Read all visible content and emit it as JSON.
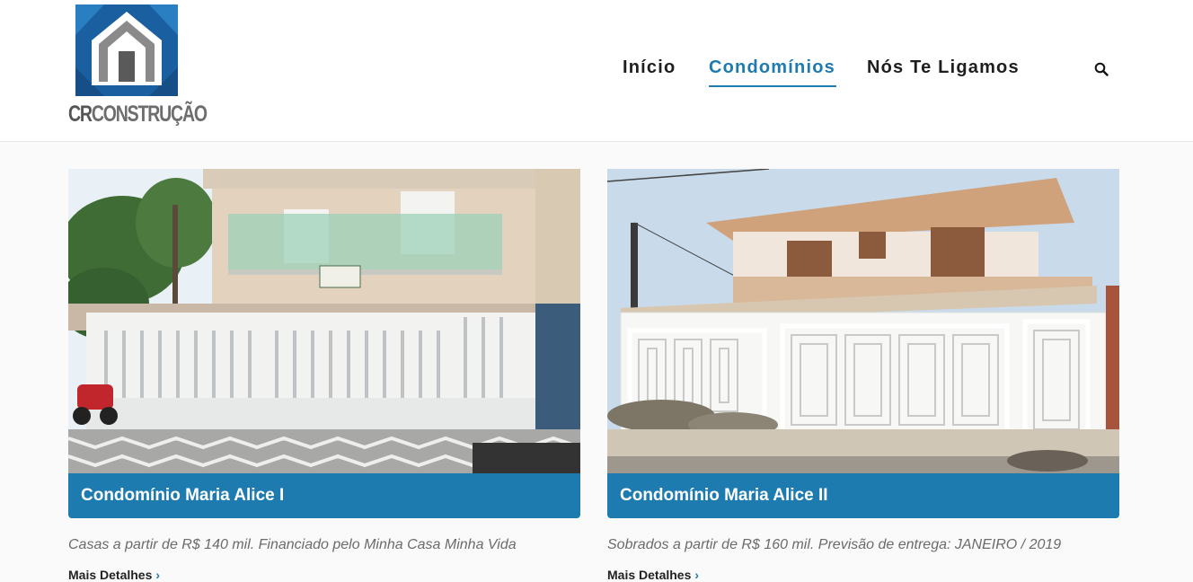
{
  "brand": {
    "logo_text_cr": "CR",
    "logo_text_rest": "CONSTRUÇÃO",
    "colors": {
      "primary": "#1e7bb0",
      "dark_blue": "#1a5a9a",
      "gray": "#7a7a7a"
    }
  },
  "nav": {
    "items": [
      {
        "label": "Início",
        "active": false
      },
      {
        "label": "Condomínios",
        "active": true
      },
      {
        "label": "Nós Te Ligamos",
        "active": false
      }
    ],
    "search_icon": "search-icon"
  },
  "cards": [
    {
      "title": "Condomínio Maria Alice I",
      "description": "Casas a partir de R$ 140 mil. Financiado pelo Minha Casa Minha Vida",
      "more_label": "Mais Detalhes",
      "more_icon": "chevron-right-icon"
    },
    {
      "title": "Condomínio Maria Alice II",
      "description": "Sobrados a partir de R$ 160 mil. Previsão de entrega: JANEIRO / 2019",
      "more_label": "Mais Detalhes",
      "more_icon": "chevron-right-icon"
    }
  ]
}
